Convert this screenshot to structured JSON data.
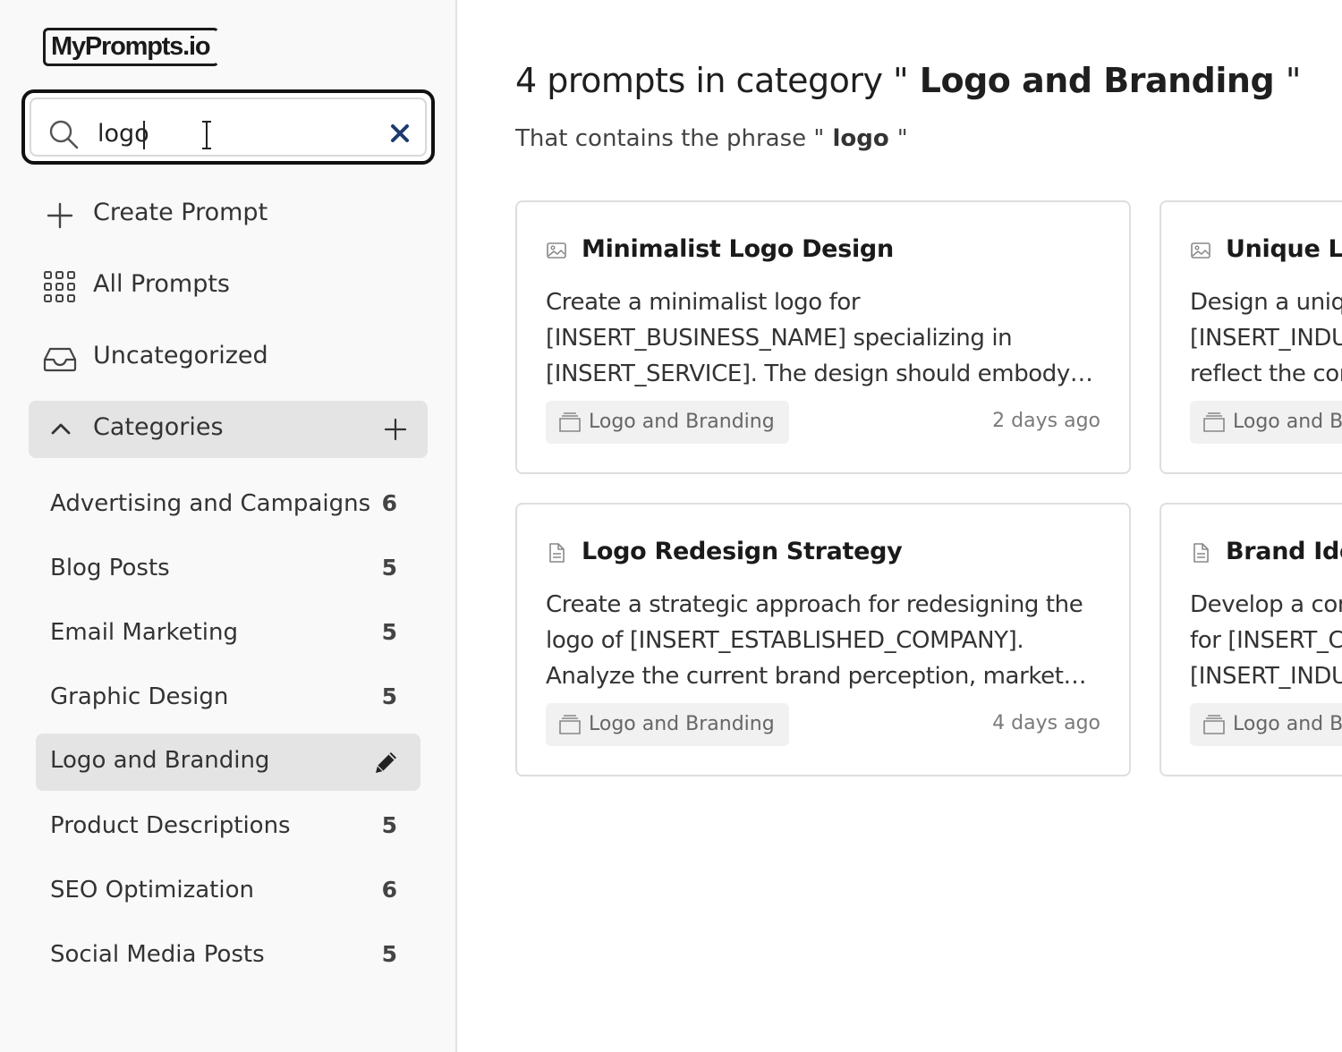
{
  "app": {
    "logo_text": "MyPrompts.io"
  },
  "search": {
    "value": "logo",
    "placeholder": ""
  },
  "nav": {
    "create_prompt": "Create Prompt",
    "all_prompts": "All Prompts",
    "uncategorized": "Uncategorized"
  },
  "categories": {
    "header": "Categories",
    "items": [
      {
        "name": "Advertising and Campaigns",
        "count": "6"
      },
      {
        "name": "Blog Posts",
        "count": "5"
      },
      {
        "name": "Email Marketing",
        "count": "5"
      },
      {
        "name": "Graphic Design",
        "count": "5"
      },
      {
        "name": "Logo and Branding",
        "count": "",
        "active": true
      },
      {
        "name": "Product Descriptions",
        "count": "5"
      },
      {
        "name": "SEO Optimization",
        "count": "6"
      },
      {
        "name": "Social Media Posts",
        "count": "5"
      }
    ]
  },
  "main": {
    "heading_prefix": "4 prompts in category \"",
    "heading_category": " Logo and Branding ",
    "heading_suffix": "\"",
    "sub_prefix": "That contains the phrase \"",
    "sub_phrase": " logo ",
    "sub_suffix": "\"",
    "cards": [
      {
        "icon": "image-icon",
        "title": "Minimalist Logo Design",
        "description": "Create a minimalist logo for [INSERT_BUSINESS_NAME] specializing in [INSERT_SERVICE]. The design should embody…",
        "category": "Logo and Branding",
        "time": "2 days ago"
      },
      {
        "icon": "image-icon",
        "title": "Unique Log",
        "description": "Design a uniqu [INSERT_INDU reflect the cor",
        "category": "Logo and Br",
        "time": ""
      },
      {
        "icon": "document-icon",
        "title": "Logo Redesign Strategy",
        "description": "Create a strategic approach for redesigning the logo of [INSERT_ESTABLISHED_COMPANY]. Analyze the current brand perception, market…",
        "category": "Logo and Branding",
        "time": "4 days ago"
      },
      {
        "icon": "document-icon",
        "title": "Brand Ider",
        "description": "Develop a com for [INSERT_C [INSERT_INDU",
        "category": "Logo and Br",
        "time": ""
      }
    ]
  },
  "colors": {
    "sidebar_bg": "#f9f9f9",
    "active_bg": "#e4e4e4",
    "clear_x": "#1e3a6e",
    "text": "#1f1f1f"
  }
}
